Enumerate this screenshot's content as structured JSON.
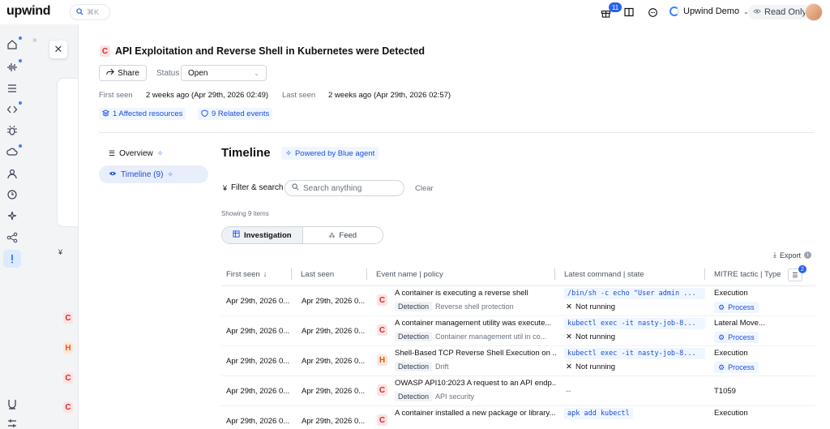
{
  "topbar": {
    "logo": "upwind",
    "search_shortcut": "⌘K",
    "notif_count": "11",
    "org_name": "Upwind Demo",
    "read_only": "Read Only"
  },
  "background": {
    "letters": [
      "C",
      "H",
      "C",
      "C"
    ]
  },
  "alert": {
    "severity": "C",
    "title": "API Exploitation and Reverse Shell in Kubernetes were Detected",
    "share": "Share",
    "status_label": "Status",
    "status_value": "Open",
    "first_seen_label": "First seen",
    "first_seen_value": "2 weeks ago (Apr 29th, 2026 02:49)",
    "last_seen_label": "Last seen",
    "last_seen_value": "2 weeks ago (Apr 29th, 2026 02:57)",
    "affected": "1 Affected resources",
    "related": "9 Related events"
  },
  "nav": {
    "overview": "Overview",
    "timeline": "Timeline (9)"
  },
  "timeline": {
    "title": "Timeline",
    "powered": "Powered by Blue agent",
    "filter": "Filter & search",
    "search_placeholder": "Search anything",
    "clear": "Clear",
    "showing": "Showing 9 items",
    "tab_investigation": "Investigation",
    "tab_feed": "Feed",
    "export": "Export",
    "columns_badge": "2",
    "headers": {
      "first_seen": "First seen",
      "last_seen": "Last seen",
      "event": "Event name | policy",
      "command": "Latest command | state",
      "mitre": "MITRE tactic | Type"
    },
    "rows": [
      {
        "first": "Apr 29th, 2026 0...",
        "last": "Apr 29th, 2026 0...",
        "sev": "C",
        "event": "A container is executing a reverse shell",
        "tag": "Detection",
        "policy": "Reverse shell protection",
        "cmd": "/bin/sh -c echo \"User admin ...",
        "state": "Not running",
        "tactic": "Execution",
        "type": "Process"
      },
      {
        "first": "Apr 29th, 2026 0...",
        "last": "Apr 29th, 2026 0...",
        "sev": "C",
        "event": "A container management utility was execute...",
        "tag": "Detection",
        "policy": "Container management util in co...",
        "cmd": "kubectl exec -it nasty-job-8...",
        "state": "Not running",
        "tactic": "Lateral Move...",
        "type": "Process"
      },
      {
        "first": "Apr 29th, 2026 0...",
        "last": "Apr 29th, 2026 0...",
        "sev": "H",
        "event": "Shell-Based TCP Reverse Shell Execution on ...",
        "tag": "Detection",
        "policy": "Drift",
        "cmd": "kubectl exec -it nasty-job-8...",
        "state": "Not running",
        "tactic": "Execution",
        "type": "Process"
      },
      {
        "first": "Apr 29th, 2026 0...",
        "last": "Apr 29th, 2026 0...",
        "sev": "C",
        "event": "OWASP API10:2023 A request to an API endp...",
        "tag": "Detection",
        "policy": "API security",
        "cmd": "--",
        "state": "",
        "tactic": "T1059",
        "type": ""
      },
      {
        "first": "Apr 29th, 2026 0...",
        "last": "Apr 29th, 2026 0...",
        "sev": "C",
        "event": "A container installed a new package or library...",
        "tag": "",
        "policy": "",
        "cmd": "apk add kubectl",
        "state": "",
        "tactic": "Execution",
        "type": ""
      }
    ]
  },
  "colors": {
    "accent": "#2563eb",
    "critical": "#dc2626",
    "high": "#ea580c"
  }
}
